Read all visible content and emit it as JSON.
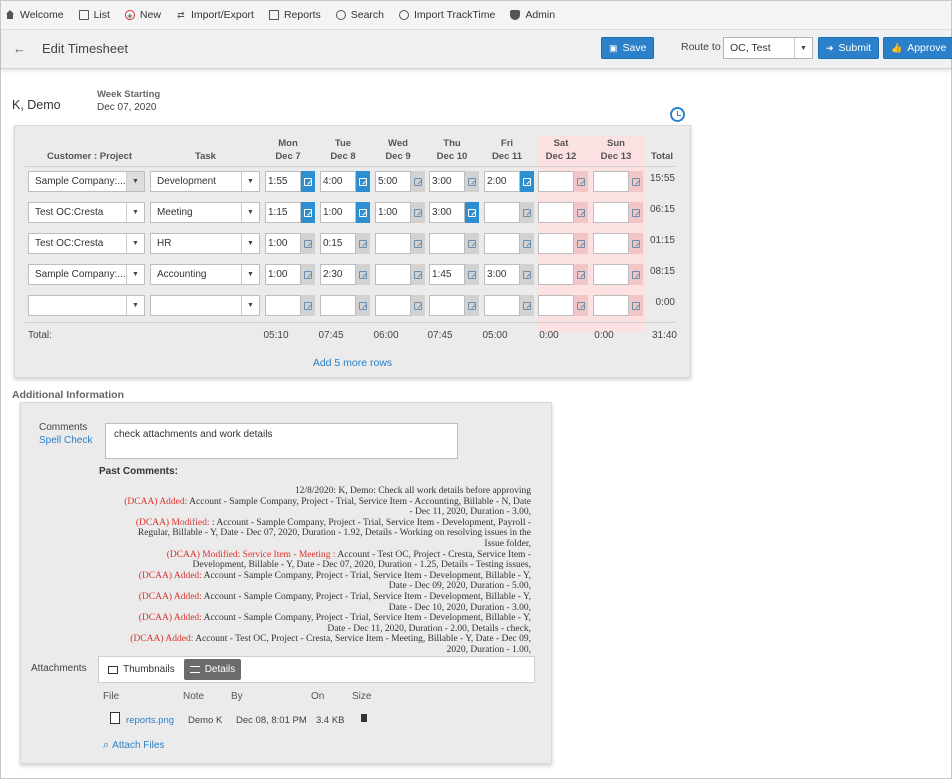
{
  "menu": [
    {
      "label": "Welcome",
      "icon": "home-icon"
    },
    {
      "label": "List",
      "icon": "list-icon"
    },
    {
      "label": "New",
      "icon": "new-icon"
    },
    {
      "label": "Import/Export",
      "icon": "import-export-icon"
    },
    {
      "label": "Reports",
      "icon": "reports-icon"
    },
    {
      "label": "Search",
      "icon": "search-icon"
    },
    {
      "label": "Import TrackTime",
      "icon": "clock-icon"
    },
    {
      "label": "Admin",
      "icon": "shield-icon"
    }
  ],
  "header": {
    "title": "Edit Timesheet",
    "save_label": "Save",
    "route_label": "Route to",
    "route_value": "OC, Test",
    "submit_label": "Submit",
    "approve_label": "Approve"
  },
  "employee": {
    "name": "K, Demo",
    "week_label": "Week Starting",
    "week_date": "Dec 07, 2020"
  },
  "grid": {
    "customer_header": "Customer : Project",
    "task_header": "Task",
    "total_header": "Total",
    "days": [
      {
        "day": "Mon",
        "date": "Dec 7"
      },
      {
        "day": "Tue",
        "date": "Dec 8"
      },
      {
        "day": "Wed",
        "date": "Dec 9"
      },
      {
        "day": "Thu",
        "date": "Dec 10"
      },
      {
        "day": "Fri",
        "date": "Dec 11"
      },
      {
        "day": "Sat",
        "date": "Dec 12"
      },
      {
        "day": "Sun",
        "date": "Dec 13"
      }
    ],
    "rows": [
      {
        "customer": "Sample Company:...",
        "task": "Development",
        "hours": [
          "1:55",
          "4:00",
          "5:00",
          "3:00",
          "2:00",
          "",
          ""
        ],
        "notes": [
          true,
          true,
          false,
          false,
          true,
          false,
          false
        ],
        "total": "15:55"
      },
      {
        "customer": "Test OC:Cresta",
        "task": "Meeting",
        "hours": [
          "1:15",
          "1:00",
          "1:00",
          "3:00",
          "",
          "",
          ""
        ],
        "notes": [
          true,
          true,
          false,
          true,
          false,
          false,
          false
        ],
        "total": "06:15"
      },
      {
        "customer": "Test OC:Cresta",
        "task": "HR",
        "hours": [
          "1:00",
          "0:15",
          "",
          "",
          "",
          "",
          ""
        ],
        "notes": [
          false,
          false,
          false,
          false,
          false,
          false,
          false
        ],
        "total": "01:15"
      },
      {
        "customer": "Sample Company:...",
        "task": "Accounting",
        "hours": [
          "1:00",
          "2:30",
          "",
          "1:45",
          "3:00",
          "",
          ""
        ],
        "notes": [
          false,
          false,
          false,
          false,
          false,
          false,
          false
        ],
        "total": "08:15"
      },
      {
        "customer": "",
        "task": "",
        "hours": [
          "",
          "",
          "",
          "",
          "",
          "",
          ""
        ],
        "notes": [
          false,
          false,
          false,
          false,
          false,
          false,
          false
        ],
        "total": "0:00"
      }
    ],
    "total_label": "Total:",
    "day_totals": [
      "05:10",
      "07:45",
      "06:00",
      "07:45",
      "05:00",
      "0:00",
      "0:00"
    ],
    "grand_total": "31:40",
    "add_rows_label": "Add 5 more rows"
  },
  "additional": {
    "title": "Additional Information",
    "comments_label": "Comments",
    "spell_check": "Spell Check",
    "comment_value": "check attachments and work details",
    "past_comments_label": "Past Comments:",
    "past_comments": [
      {
        "tag": "",
        "text": "12/8/2020: K, Demo: Check all work details before approving"
      },
      {
        "tag": "(DCAA) Added:",
        "text": " Account - Sample Company, Project - Trial, Service Item - Accounting, Billable - N, Date - Dec 11, 2020, Duration - 3.00,"
      },
      {
        "tag": "(DCAA) Modified:",
        "text": " : Account - Sample Company, Project - Trial, Service Item - Development, Payroll - Regular, Billable - Y, Date - Dec 07, 2020, Duration - 1.92, Details - Working on resolving issues in the Issue folder,"
      },
      {
        "tag": "(DCAA) Modified: Service Item - Meeting :",
        "text": " Account - Test OC, Project - Cresta, Service Item - Development, Billable - Y, Date - Dec 07, 2020, Duration - 1.25, Details - Testing issues,"
      },
      {
        "tag": "(DCAA) Added:",
        "text": " Account - Sample Company, Project - Trial, Service Item - Development, Billable - Y, Date - Dec 09, 2020, Duration - 5.00,"
      },
      {
        "tag": "(DCAA) Added:",
        "text": " Account - Sample Company, Project - Trial, Service Item - Development, Billable - Y, Date - Dec 10, 2020, Duration - 3.00,"
      },
      {
        "tag": "(DCAA) Added:",
        "text": " Account - Sample Company, Project - Trial, Service Item - Development, Billable - Y, Date - Dec 11, 2020, Duration - 2.00, Details - check,"
      },
      {
        "tag": "(DCAA) Added:",
        "text": " Account - Test OC, Project - Cresta, Service Item - Meeting, Billable - Y, Date - Dec 09, 2020, Duration - 1.00,"
      }
    ],
    "attachments_label": "Attachments",
    "tabs": [
      "Thumbnails",
      "Details"
    ],
    "columns": [
      "File",
      "Note",
      "By",
      "On",
      "Size"
    ],
    "files": [
      {
        "name": "reports.png",
        "note": "Demo K",
        "by": "Dec 08, 8:01 PM",
        "size": "3.4 KB"
      }
    ],
    "attach_label": "Attach Files"
  },
  "colors": {
    "accent": "#2b80c9",
    "weekend": "#fbe1e1",
    "note_filled": "#2d8fcf",
    "log_red": "#d9332c"
  }
}
